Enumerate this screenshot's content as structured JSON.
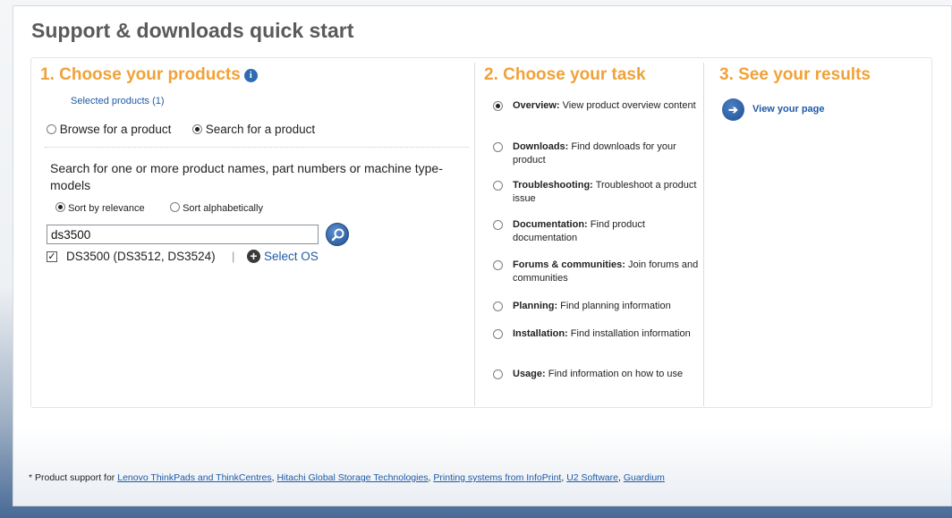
{
  "page_title": "Support & downloads quick start",
  "step1": {
    "heading": "1. Choose your products",
    "selected_products": "Selected products (1)",
    "mode_browse": "Browse for a product",
    "mode_search": "Search for a product",
    "search_hint": "Search for one or more product names, part numbers or machine type-models",
    "sort_relevance": "Sort by relevance",
    "sort_alpha": "Sort alphabetically",
    "search_value": "ds3500",
    "result_item": "DS3500 (DS3512, DS3524)",
    "result_separator": "|",
    "select_os": "Select OS"
  },
  "step2": {
    "heading": "2. Choose your task",
    "tasks": [
      {
        "label": "Overview:",
        "desc": "View product overview content",
        "selected": true
      },
      {
        "label": "Downloads:",
        "desc": "Find downloads for your product",
        "selected": false
      },
      {
        "label": "Troubleshooting:",
        "desc": "Troubleshoot a product issue",
        "selected": false
      },
      {
        "label": "Documentation:",
        "desc": "Find product documentation",
        "selected": false
      },
      {
        "label": "Forums & communities:",
        "desc": "Join forums and communities",
        "selected": false
      },
      {
        "label": "Planning:",
        "desc": "Find planning information",
        "selected": false
      },
      {
        "label": "Installation:",
        "desc": "Find installation information",
        "selected": false
      },
      {
        "label": "Usage:",
        "desc": "Find information on how to use",
        "selected": false
      }
    ]
  },
  "step3": {
    "heading": "3. See your results",
    "view_page": "View your page"
  },
  "footer": {
    "prefix": "* Product support for",
    "links": [
      "Lenovo ThinkPads and ThinkCentres",
      "Hitachi Global Storage Technologies",
      "Printing systems from InfoPrint",
      "U2 Software",
      "Guardium"
    ]
  },
  "colors": {
    "accent_orange": "#f0a238",
    "link_blue": "#1f5aa6",
    "title_gray": "#5a5a5a"
  }
}
